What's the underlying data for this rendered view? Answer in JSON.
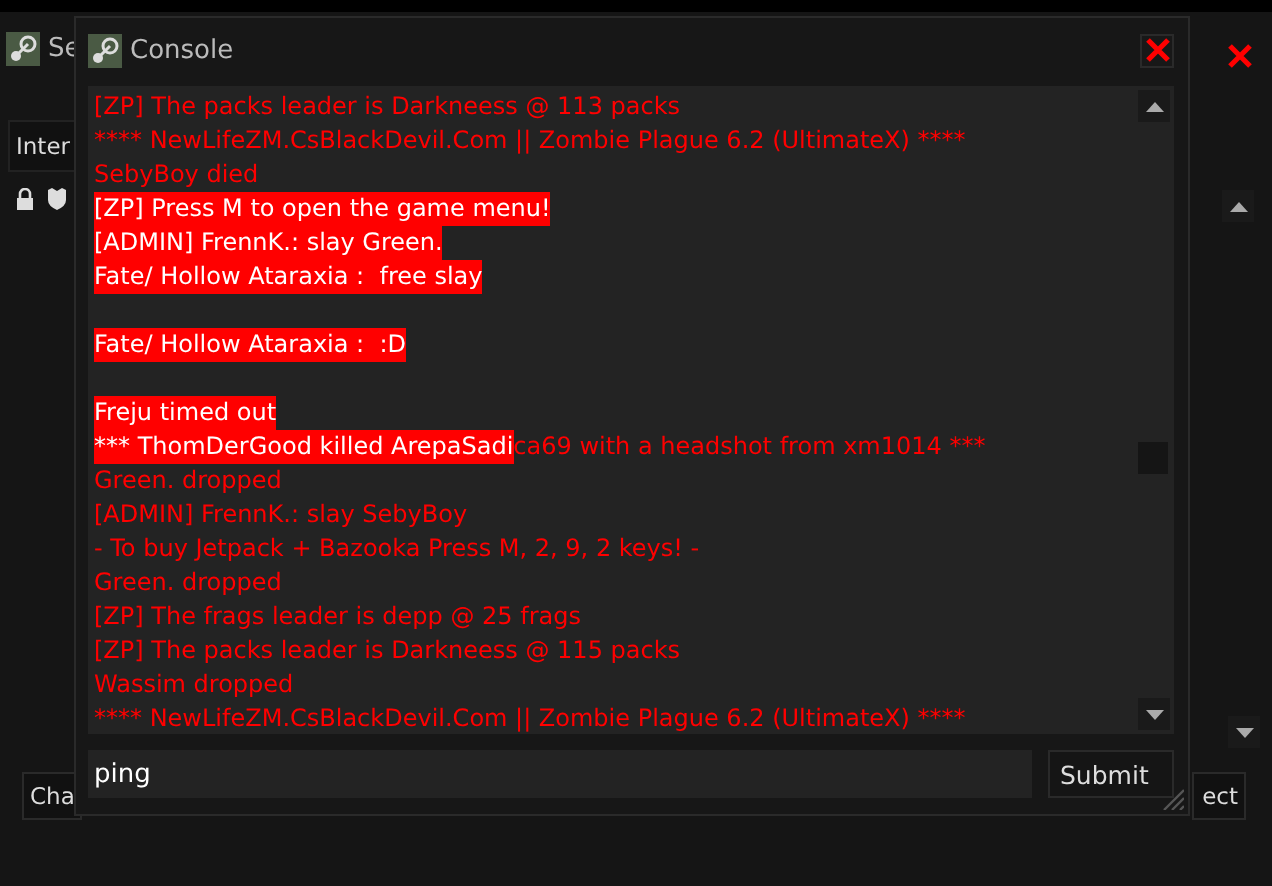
{
  "back_window": {
    "title": "Se",
    "tab": {
      "label": "Inter",
      "selected": true
    },
    "buttons": [
      "Cha",
      "ect"
    ]
  },
  "console": {
    "title": "Console",
    "lines": [
      {
        "kind": "text",
        "segments": [
          {
            "text": "[ZP] The packs leader is Darkneess @ 113 packs",
            "highlighted": false
          }
        ]
      },
      {
        "kind": "text",
        "segments": [
          {
            "text": "**** NewLifeZM.CsBlackDevil.Com || Zombie Plague 6.2 (UltimateX) ****",
            "highlighted": false
          }
        ]
      },
      {
        "kind": "text",
        "segments": [
          {
            "text": "SebyBoy died",
            "highlighted": false
          }
        ]
      },
      {
        "kind": "text",
        "segments": [
          {
            "text": "[ZP] Press M to open the game menu!",
            "highlighted": true
          }
        ]
      },
      {
        "kind": "text",
        "segments": [
          {
            "text": "[ADMIN] FrennK.: slay Green.",
            "highlighted": true
          }
        ]
      },
      {
        "kind": "text",
        "segments": [
          {
            "text": "Fate/ Hollow Ataraxia :  free slay",
            "highlighted": true
          }
        ]
      },
      {
        "kind": "blank"
      },
      {
        "kind": "text",
        "segments": [
          {
            "text": "Fate/ Hollow Ataraxia :  :D",
            "highlighted": true
          }
        ]
      },
      {
        "kind": "blank"
      },
      {
        "kind": "text",
        "segments": [
          {
            "text": "Freju timed out",
            "highlighted": true
          }
        ]
      },
      {
        "kind": "text",
        "segments": [
          {
            "text": "*** ThomDerGood killed ArepaSadi",
            "highlighted": true
          },
          {
            "text": "ca69 with a headshot from xm1014 ***",
            "highlighted": false
          }
        ]
      },
      {
        "kind": "text",
        "segments": [
          {
            "text": "Green. dropped",
            "highlighted": false
          }
        ]
      },
      {
        "kind": "text",
        "segments": [
          {
            "text": "[ADMIN] FrennK.: slay SebyBoy",
            "highlighted": false
          }
        ]
      },
      {
        "kind": "text",
        "segments": [
          {
            "text": "- To buy Jetpack + Bazooka Press M, 2, 9, 2 keys! -",
            "highlighted": false
          }
        ]
      },
      {
        "kind": "text",
        "segments": [
          {
            "text": "Green. dropped",
            "highlighted": false
          }
        ]
      },
      {
        "kind": "text",
        "segments": [
          {
            "text": "[ZP] The frags leader is depp @ 25 frags",
            "highlighted": false
          }
        ]
      },
      {
        "kind": "text",
        "segments": [
          {
            "text": "[ZP] The packs leader is Darkneess @ 115 packs",
            "highlighted": false
          }
        ]
      },
      {
        "kind": "text",
        "segments": [
          {
            "text": "Wassim dropped",
            "highlighted": false
          }
        ]
      },
      {
        "kind": "text",
        "segments": [
          {
            "text": "**** NewLifeZM.CsBlackDevil.Com || Zombie Plague 6.2 (UltimateX) ****",
            "highlighted": false
          }
        ]
      }
    ],
    "input": {
      "value": "ping"
    },
    "submit": "Submit"
  }
}
